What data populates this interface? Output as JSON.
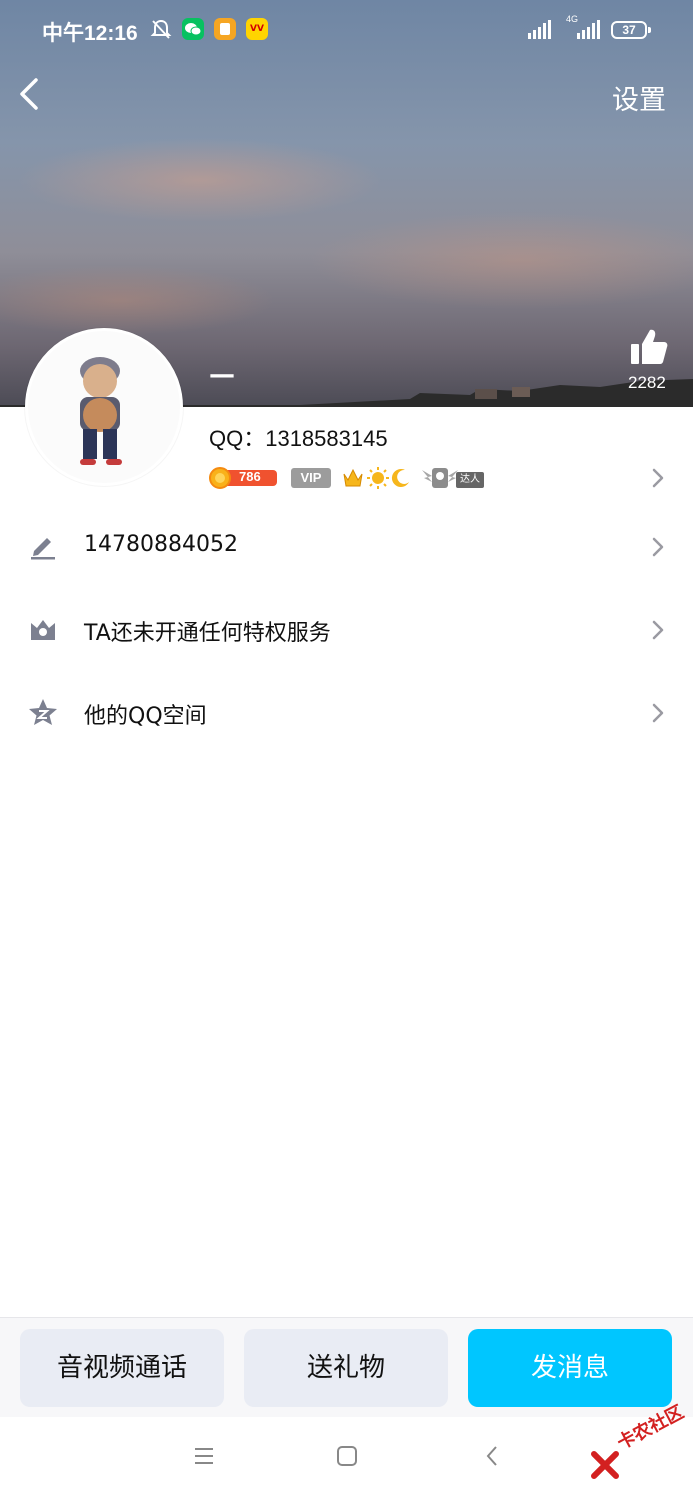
{
  "status_bar": {
    "time": "中午12:16",
    "network": "4G",
    "battery": "37"
  },
  "header": {
    "settings_label": "设置",
    "nickname": "—",
    "like_count": "2282"
  },
  "profile": {
    "qq_number": "QQ：1318583145",
    "coin_level": "786",
    "vip_label": "VIP",
    "expert_label": "达人"
  },
  "rows": [
    {
      "icon": "pencil-icon",
      "label": "14780884052"
    },
    {
      "icon": "crown-shield-icon",
      "label": "TA还未开通任何特权服务"
    },
    {
      "icon": "star-z-icon",
      "label": "他的QQ空间"
    }
  ],
  "actions": {
    "call_label": "音视频通话",
    "gift_label": "送礼物",
    "message_label": "发消息"
  },
  "watermark": "卡农社区",
  "colors": {
    "accent": "#00c6ff",
    "secondary_button": "#e9ecf4",
    "icon_gray": "#7c8090"
  }
}
